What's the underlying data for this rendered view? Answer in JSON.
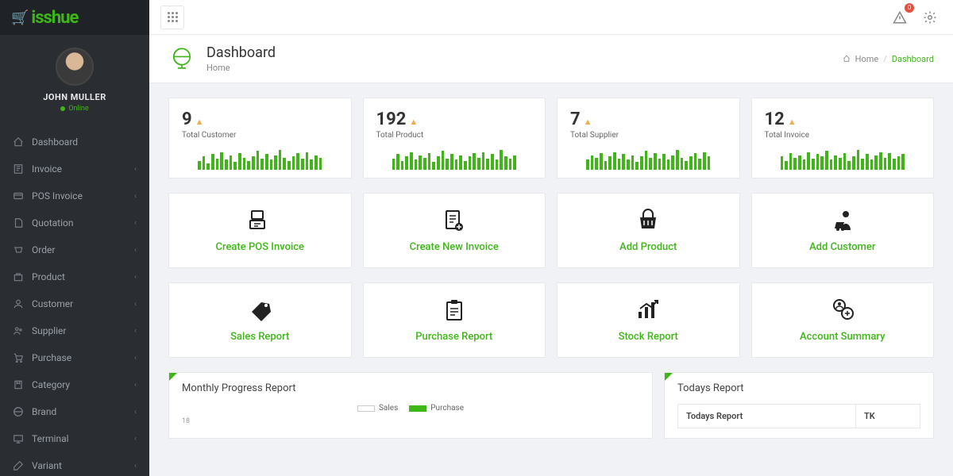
{
  "brand": "isshue",
  "user": {
    "name": "JOHN MULLER",
    "status": "Online"
  },
  "nav": [
    {
      "label": "Dashboard",
      "expandable": false
    },
    {
      "label": "Invoice",
      "expandable": true
    },
    {
      "label": "POS Invoice",
      "expandable": true
    },
    {
      "label": "Quotation",
      "expandable": true
    },
    {
      "label": "Order",
      "expandable": true
    },
    {
      "label": "Product",
      "expandable": true
    },
    {
      "label": "Customer",
      "expandable": true
    },
    {
      "label": "Supplier",
      "expandable": true
    },
    {
      "label": "Purchase",
      "expandable": true
    },
    {
      "label": "Category",
      "expandable": true
    },
    {
      "label": "Brand",
      "expandable": true
    },
    {
      "label": "Terminal",
      "expandable": true
    },
    {
      "label": "Variant",
      "expandable": true
    }
  ],
  "notifications": {
    "count": "0"
  },
  "page": {
    "title": "Dashboard",
    "subtitle": "Home"
  },
  "breadcrumb": {
    "home": "Home",
    "current": "Dashboard"
  },
  "stats": [
    {
      "value": "9",
      "label": "Total Customer"
    },
    {
      "value": "192",
      "label": "Total Product"
    },
    {
      "value": "7",
      "label": "Total Supplier"
    },
    {
      "value": "12",
      "label": "Total Invoice"
    }
  ],
  "actions_row1": [
    {
      "label": "Create POS Invoice"
    },
    {
      "label": "Create New Invoice"
    },
    {
      "label": "Add Product"
    },
    {
      "label": "Add Customer"
    }
  ],
  "actions_row2": [
    {
      "label": "Sales Report"
    },
    {
      "label": "Purchase Report"
    },
    {
      "label": "Stock Report"
    },
    {
      "label": "Account Summary"
    }
  ],
  "monthly_report": {
    "title": "Monthly Progress Report",
    "legend": {
      "sales": "Sales",
      "purchase": "Purchase"
    },
    "y_tick": "18"
  },
  "todays_report": {
    "title": "Todays Report",
    "col1": "Todays Report",
    "col2": "TK"
  }
}
